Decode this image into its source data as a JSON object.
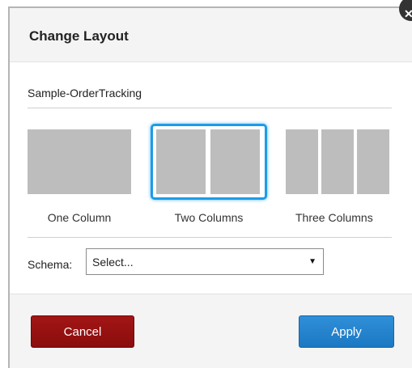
{
  "dialog": {
    "title": "Change Layout",
    "close_icon": "close-icon"
  },
  "report_name": "Sample-OrderTracking",
  "layouts": [
    {
      "label": "One Column",
      "selected": false
    },
    {
      "label": "Two Columns",
      "selected": true
    },
    {
      "label": "Three Columns",
      "selected": false
    }
  ],
  "schema": {
    "label": "Schema:",
    "value": "Select...",
    "arrow_icon": "dropdown-arrow-icon"
  },
  "footer": {
    "cancel_label": "Cancel",
    "apply_label": "Apply"
  },
  "colors": {
    "selected_border": "#1e9be8",
    "cancel_bg": "#9b1212",
    "apply_bg": "#2584cf",
    "thumb_fill": "#bdbdbd"
  }
}
